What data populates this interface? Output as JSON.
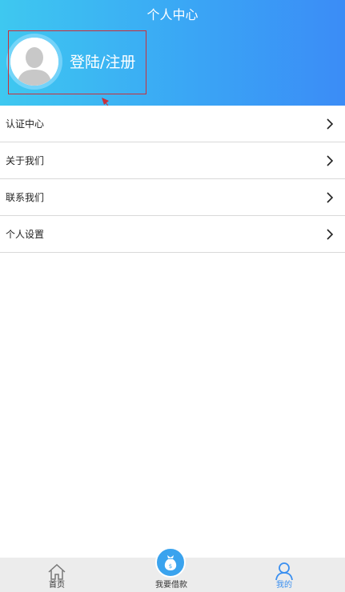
{
  "header": {
    "title": "个人中心",
    "login_label": "登陆/注册"
  },
  "menu": {
    "items": [
      {
        "label": "认证中心",
        "icon": "chevron-right-icon"
      },
      {
        "label": "关于我们",
        "icon": "chevron-right-icon"
      },
      {
        "label": "联系我们",
        "icon": "chevron-right-icon"
      },
      {
        "label": "个人设置",
        "icon": "chevron-right-icon"
      }
    ]
  },
  "tabbar": {
    "tabs": [
      {
        "label": "首页",
        "icon": "home-icon",
        "active": false
      },
      {
        "label": "我要借款",
        "icon": "money-bag-icon",
        "active": false
      },
      {
        "label": "我的",
        "icon": "user-icon",
        "active": true
      }
    ]
  },
  "colors": {
    "header_gradient_start": "#3ec8f0",
    "header_gradient_end": "#3b8cf6",
    "accent": "#3a8ff0",
    "annotation": "#c9303a"
  }
}
